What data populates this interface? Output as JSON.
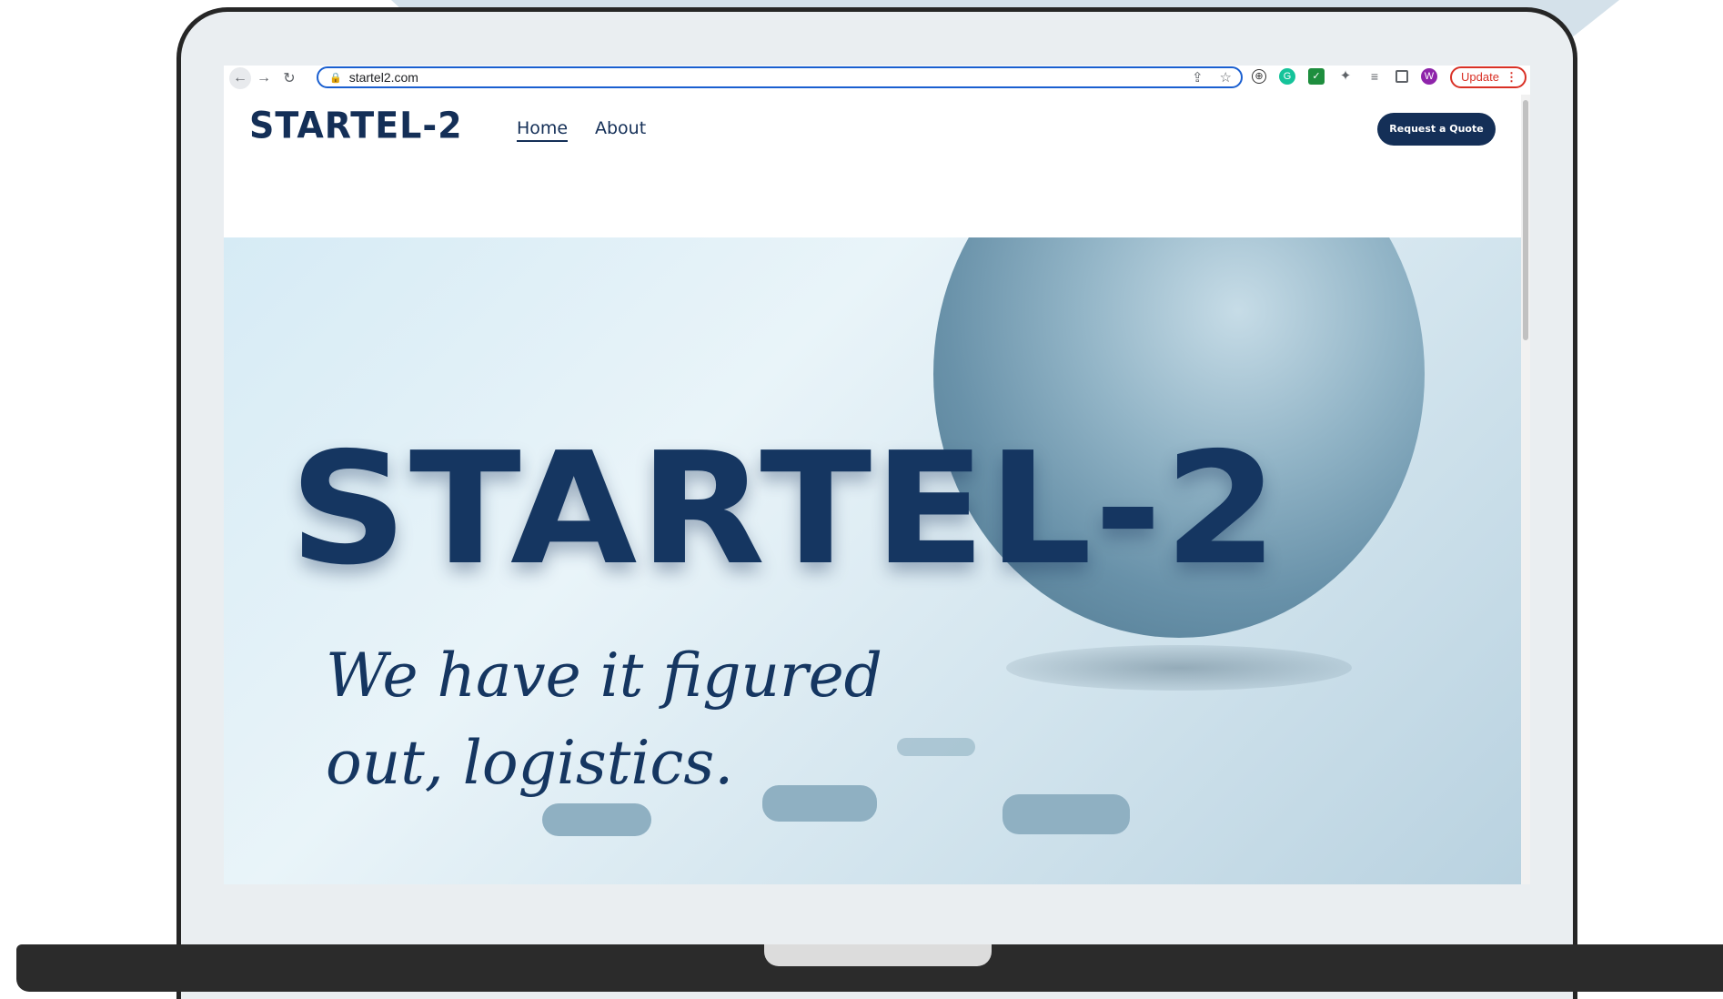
{
  "browser": {
    "url": "startel2.com",
    "update_label": "Update",
    "profile_initial": "W"
  },
  "site": {
    "logo": "STARTEL-2",
    "nav": {
      "home": "Home",
      "about": "About"
    },
    "cta": "Request a Quote"
  },
  "hero": {
    "title": "STARTEL-2",
    "tagline_line1": "We have it figured",
    "tagline_line2": "out, logistics."
  },
  "colors": {
    "brand_navy": "#142f57",
    "chrome_accent": "#1a5fd0",
    "update_red": "#d93025"
  }
}
